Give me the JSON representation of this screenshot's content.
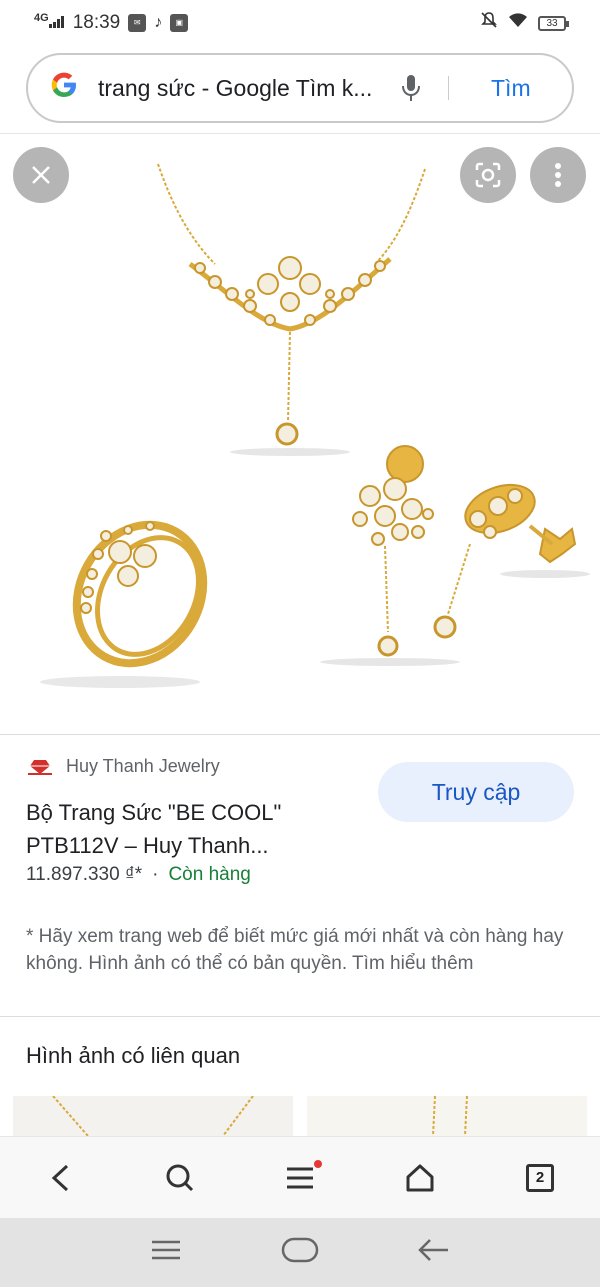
{
  "status_bar": {
    "network": "4G",
    "time": "18:39",
    "battery": "33"
  },
  "search": {
    "query": "trang sức - Google Tìm k...",
    "search_button": "Tìm"
  },
  "result": {
    "source_name": "Huy Thanh Jewelry",
    "title": "Bộ Trang Sức \"BE COOL\" PTB112V – Huy Thanh...",
    "price": "11.897.330 ₫*",
    "separator": "·",
    "availability": "Còn hàng",
    "visit_button": "Truy cập",
    "note": "* Hãy xem trang web để biết mức giá mới nhất và còn hàng hay không. Hình ảnh có thể có bản quyền. Tìm hiểu thêm"
  },
  "related": {
    "heading": "Hình ảnh có liên quan"
  },
  "bottom_nav": {
    "tab_count": "2"
  },
  "colors": {
    "accent": "#1a73e8",
    "in_stock": "#188038",
    "gold": "#d9a93a"
  }
}
